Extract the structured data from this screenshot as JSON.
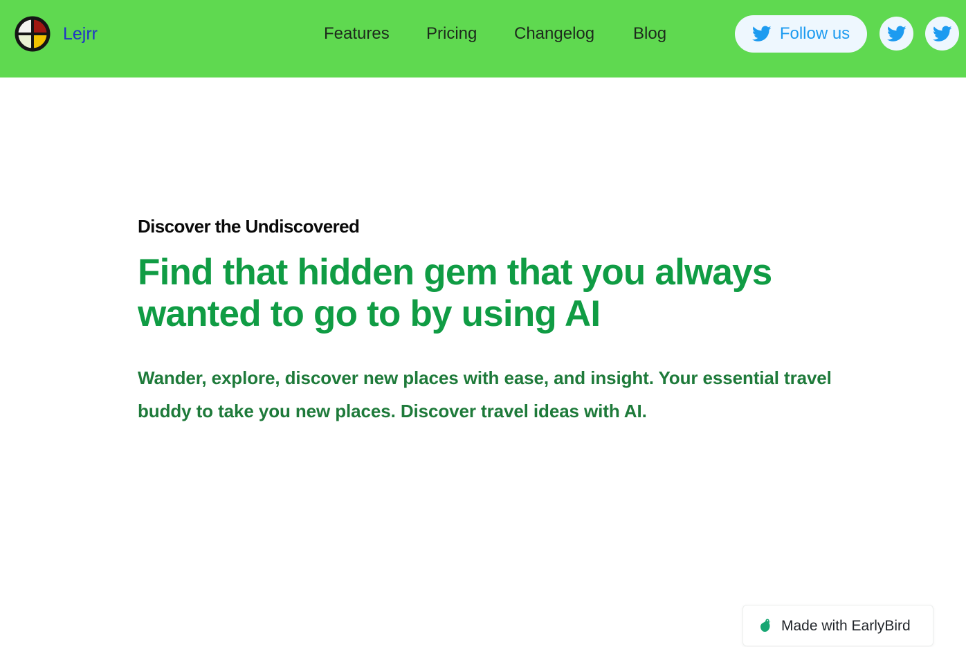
{
  "header": {
    "brand": {
      "name": "Lejrr"
    },
    "nav": [
      {
        "label": "Features"
      },
      {
        "label": "Pricing"
      },
      {
        "label": "Changelog"
      },
      {
        "label": "Blog"
      }
    ],
    "follow_button": {
      "label": "Follow us",
      "icon": "twitter-icon"
    },
    "social_buttons": [
      {
        "icon": "twitter-icon"
      },
      {
        "icon": "twitter-icon"
      }
    ]
  },
  "hero": {
    "eyebrow": "Discover the Undiscovered",
    "headline": "Find that hidden gem that you always wanted to go to by using AI",
    "subheadline": "Wander, explore, discover new places with ease, and insight. Your essential travel buddy to take you new places. Discover travel ideas with AI."
  },
  "footer_badge": {
    "label": "Made with EarlyBird",
    "icon": "earlybird-icon"
  },
  "colors": {
    "header_bg": "#5fd950",
    "brand_text": "#2033c7",
    "headline": "#109c44",
    "subheadline": "#1e7a3a",
    "twitter_blue": "#1d9bf0",
    "follow_bg": "#eef7fe"
  }
}
